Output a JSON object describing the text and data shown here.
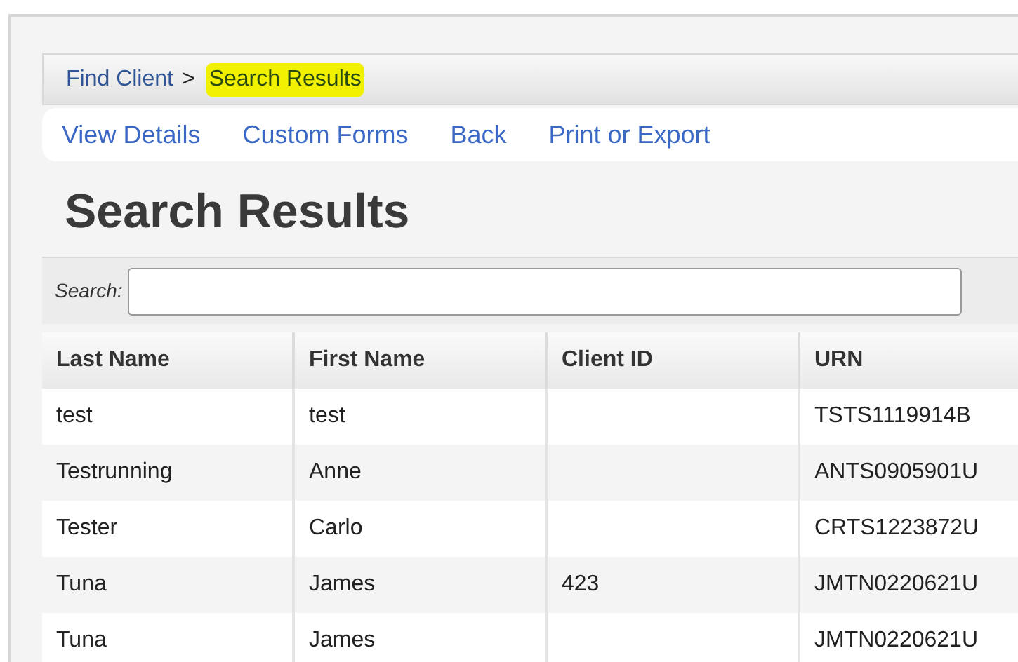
{
  "breadcrumb": [
    {
      "label": "Find Client",
      "separator": ">",
      "highlighted": false
    },
    {
      "label": "Search Results",
      "highlighted": true
    }
  ],
  "actions": [
    "View Details",
    "Custom Forms",
    "Back",
    "Print or Export"
  ],
  "title": "Search Results",
  "search": {
    "label": "Search:"
  },
  "table": {
    "columns": [
      "Last Name",
      "First Name",
      "Client ID",
      "URN"
    ],
    "rows": [
      [
        "test",
        "test",
        "",
        "TSTS1119914B"
      ],
      [
        "Testrunning",
        "Anne",
        "",
        "ANTS0905901U"
      ],
      [
        "Tester",
        "Carlo",
        "",
        "CRTS1223872U"
      ],
      [
        "Tuna",
        "James",
        "423",
        "JMTN0220621U"
      ],
      [
        "Tuna",
        "James",
        "",
        "JMTN0220621U"
      ]
    ]
  }
}
